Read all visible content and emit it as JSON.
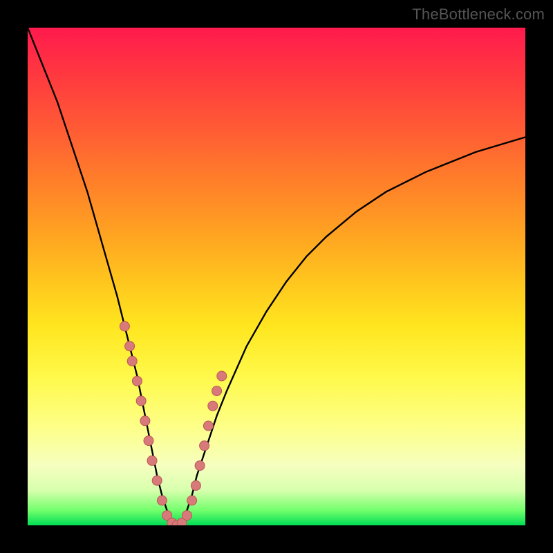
{
  "watermark": "TheBottleneck.com",
  "colors": {
    "curve": "#000000",
    "dot_fill": "#d97a7a",
    "dot_stroke": "#b85757"
  },
  "chart_data": {
    "type": "line",
    "title": "",
    "xlabel": "",
    "ylabel": "",
    "xlim": [
      0,
      100
    ],
    "ylim": [
      0,
      100
    ],
    "grid": false,
    "legend": false,
    "series": [
      {
        "name": "bottleneck-curve",
        "x": [
          0,
          2,
          4,
          6,
          8,
          10,
          12,
          14,
          16,
          18,
          20,
          22,
          24,
          25,
          26,
          27,
          28,
          29,
          30,
          31,
          32,
          33,
          34,
          36,
          38,
          40,
          44,
          48,
          52,
          56,
          60,
          66,
          72,
          80,
          90,
          100
        ],
        "y": [
          100,
          95,
          90,
          85,
          79,
          73,
          67,
          60,
          53,
          46,
          38,
          30,
          20,
          15,
          10,
          6,
          3,
          1,
          0,
          1,
          3,
          6,
          10,
          16,
          22,
          27,
          36,
          43,
          49,
          54,
          58,
          63,
          67,
          71,
          75,
          78
        ]
      }
    ],
    "highlight_dots": {
      "name": "dot-markers",
      "x": [
        19.5,
        20.5,
        21.0,
        22.0,
        22.8,
        23.6,
        24.3,
        25.0,
        26.0,
        27.0,
        28.0,
        29.0,
        30.0,
        31.0,
        32.0,
        33.0,
        33.8,
        34.6,
        35.5,
        36.3,
        37.2,
        38.0,
        39.0
      ],
      "y": [
        40,
        36,
        33,
        29,
        25,
        21,
        17,
        13,
        9,
        5,
        2,
        0.5,
        0,
        0.5,
        2,
        5,
        8,
        12,
        16,
        20,
        24,
        27,
        30
      ],
      "radius": 7
    }
  }
}
